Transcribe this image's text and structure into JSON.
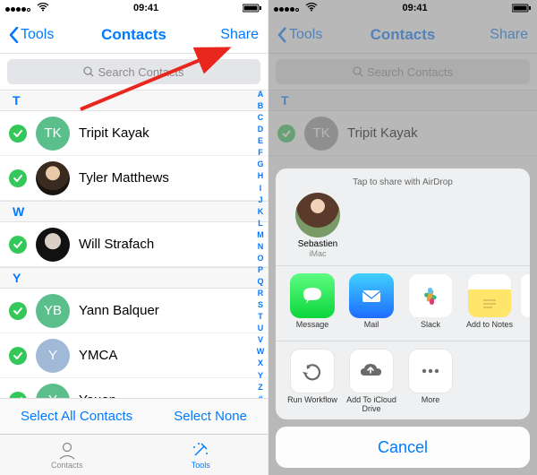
{
  "status": {
    "time": "09:41",
    "carrier_wifi": true
  },
  "nav": {
    "back_label": "Tools",
    "title": "Contacts",
    "right_label": "Share"
  },
  "search": {
    "placeholder": "Search Contacts"
  },
  "sections": {
    "t": "T",
    "w": "W",
    "y": "Y"
  },
  "contacts": {
    "c0": {
      "name": "Tripit Kayak",
      "initials": "TK",
      "color": "#5bbf8c",
      "photo": false
    },
    "c1": {
      "name": "Tyler Matthews",
      "initials": "",
      "color": "#888",
      "photo": true
    },
    "c2": {
      "name": "Will Strafach",
      "initials": "",
      "color": "#888",
      "photo": true
    },
    "c3": {
      "name": "Yann Balquer",
      "initials": "YB",
      "color": "#5bbf8c",
      "photo": false
    },
    "c4": {
      "name": "YMCA",
      "initials": "Y",
      "color": "#9fb9d6",
      "photo": false
    },
    "c5": {
      "name": "Youen",
      "initials": "Y",
      "color": "#5bbf8c",
      "photo": false
    }
  },
  "index_letters": [
    "A",
    "B",
    "C",
    "D",
    "E",
    "F",
    "G",
    "H",
    "I",
    "J",
    "K",
    "L",
    "M",
    "N",
    "O",
    "P",
    "Q",
    "R",
    "S",
    "T",
    "U",
    "V",
    "W",
    "X",
    "Y",
    "Z",
    "#"
  ],
  "bottom_actions": {
    "select_all": "Select All Contacts",
    "select_none": "Select None"
  },
  "tabbar": {
    "contacts": "Contacts",
    "tools": "Tools"
  },
  "share_sheet": {
    "airdrop_prompt": "Tap to share with AirDrop",
    "airdrop_target": {
      "name": "Sebastien",
      "device": "iMac"
    },
    "apps": {
      "a0": "Message",
      "a1": "Mail",
      "a2": "Slack",
      "a3": "Add to Notes"
    },
    "actions": {
      "b0": "Run Workflow",
      "b1": "Add To iCloud Drive",
      "b2": "More"
    },
    "cancel": "Cancel"
  }
}
